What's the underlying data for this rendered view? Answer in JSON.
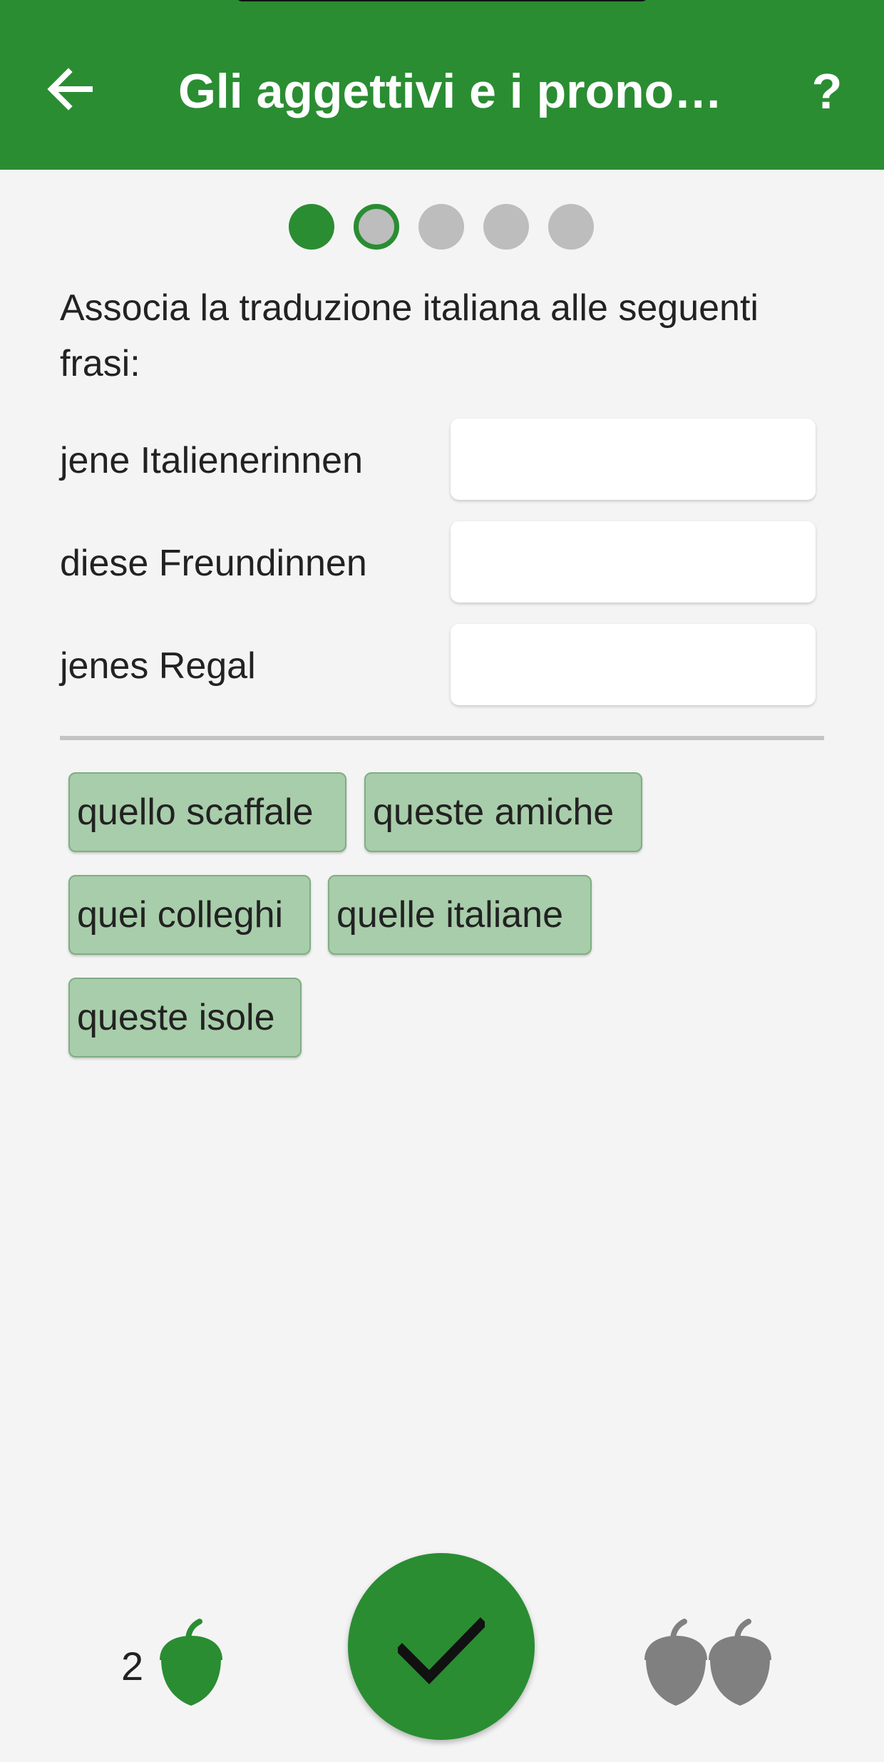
{
  "header": {
    "title": "Gli aggettivi e i pronom…",
    "help_label": "?"
  },
  "progress": {
    "total_steps": 5,
    "completed_steps": 1,
    "current_step": 2
  },
  "exercise": {
    "instruction": "Associa la traduzione italiana alle seguenti\n frasi:",
    "rows": [
      {
        "label": "jene Italienerinnen",
        "answer": ""
      },
      {
        "label": "diese Freundinnen",
        "answer": ""
      },
      {
        "label": "jenes Regal",
        "answer": ""
      }
    ],
    "options": [
      "quello scaffale",
      "queste amiche",
      "quei colleghi",
      "quelle italiane",
      "queste isole"
    ]
  },
  "footer": {
    "acorn_count": "2",
    "icons": {
      "earned": "acorn-icon",
      "confirm": "checkmark-icon",
      "hint": "double-acorn-icon"
    }
  },
  "colors": {
    "primary": "#2a8d32",
    "chip": "#a8cdaa",
    "inactive": "#bdbdbd",
    "background": "#f4f4f4",
    "acorn_grey": "#808080"
  }
}
